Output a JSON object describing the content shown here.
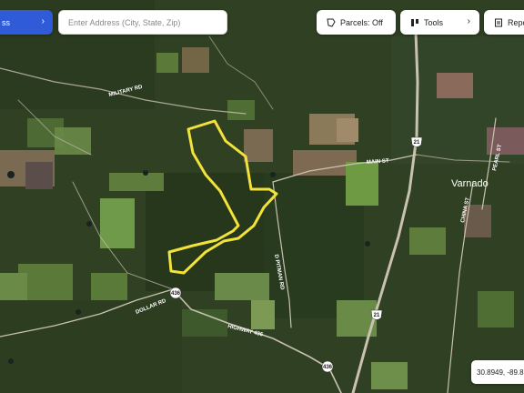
{
  "toolbar": {
    "address_button_label": "ss",
    "search_placeholder": "Enter Address (City, State, Zip)",
    "parcels_label": "Parcels: Off",
    "tools_label": "Tools",
    "reports_label": "Repor"
  },
  "map": {
    "roads": {
      "military_rd": "MILITARY RD",
      "main_st": "MAIN ST",
      "d_pitman_rd": "D PITMAN RD",
      "dollar_rd": "DOLLAR RD",
      "highway_436": "HIGHWAY 436",
      "china_st": "CHINA ST",
      "pearl_st": "PEARL ST"
    },
    "town": "Varnado",
    "shields": {
      "hwy21_north": "21",
      "hwy21_south": "21",
      "hwy436_west": "436",
      "hwy436_east": "436"
    },
    "boundary_color": "#f2e23a"
  },
  "coordinates": "30.8949, -89.86"
}
